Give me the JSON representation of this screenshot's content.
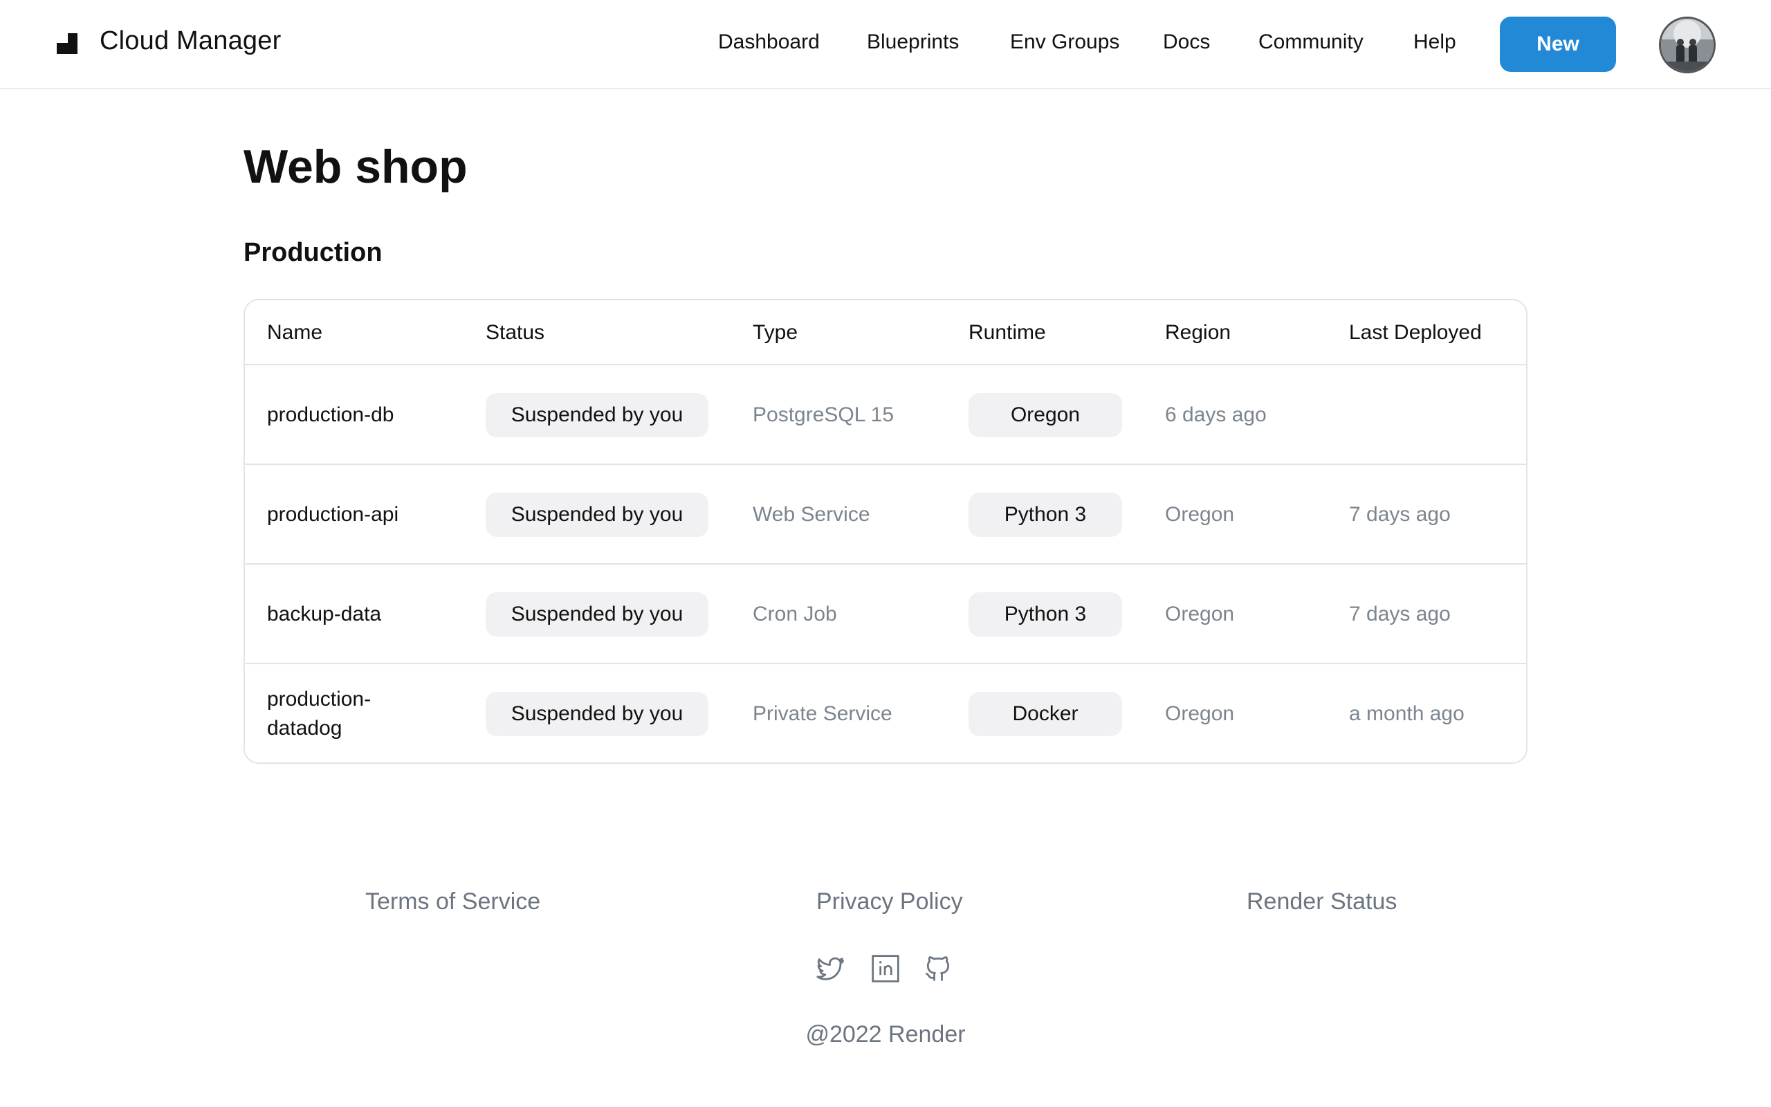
{
  "app": {
    "brand": "Cloud Manager"
  },
  "nav": {
    "items": [
      "Dashboard",
      "Blueprints",
      "Env Groups",
      "Docs",
      "Community",
      "Help"
    ],
    "new_label": "New"
  },
  "page": {
    "title": "Web shop",
    "section": "Production"
  },
  "table": {
    "columns": [
      "Name",
      "Status",
      "Type",
      "Runtime",
      "Region",
      "Last Deployed"
    ],
    "rows": [
      {
        "name": "production-db",
        "status": "Suspended by you",
        "type": "PostgreSQL 15",
        "runtime": "Oregon",
        "region": "6 days ago",
        "last_deployed": ""
      },
      {
        "name": "production-api",
        "status": "Suspended by you",
        "type": "Web Service",
        "runtime": "Python 3",
        "region": "Oregon",
        "last_deployed": "7 days ago"
      },
      {
        "name": "backup-data",
        "status": "Suspended by you",
        "type": "Cron Job",
        "runtime": "Python 3",
        "region": "Oregon",
        "last_deployed": "7 days ago"
      },
      {
        "name": "production-datadog",
        "status": "Suspended by you",
        "type": "Private Service",
        "runtime": "Docker",
        "region": "Oregon",
        "last_deployed": "a month ago"
      }
    ]
  },
  "footer": {
    "links": [
      "Terms of Service",
      "Privacy Policy",
      "Render Status"
    ],
    "social_icons": [
      "twitter-icon",
      "linkedin-icon",
      "github-icon"
    ],
    "copyright": "@2022 Render"
  },
  "colors": {
    "accent": "#2289d6",
    "pill_bg": "#f1f1f3",
    "muted_text": "#7c858f",
    "border": "#e4e4e4"
  }
}
